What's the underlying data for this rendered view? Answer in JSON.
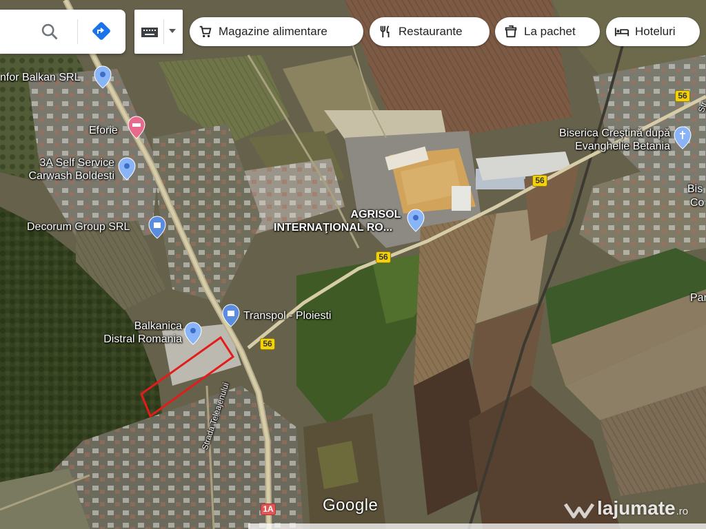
{
  "search": {
    "placeholder": ""
  },
  "filters": [
    {
      "label": "Magazine alimentare",
      "icon": "cart-icon"
    },
    {
      "label": "Restaurante",
      "icon": "fork-knife-icon"
    },
    {
      "label": "La pachet",
      "icon": "takeout-bag-icon"
    },
    {
      "label": "Hoteluri",
      "icon": "bed-icon"
    }
  ],
  "places": {
    "comfor": "nfor Balkan SRL",
    "eforie": "Eforie",
    "carwash_1": "3A Self Service",
    "carwash_2": "Carwash Boldesti",
    "decorum": "Decorum Group SRL",
    "agrisol_1": "AGRISOL",
    "agrisol_2": "INTERNAŢIONAL RO...",
    "transpol": "Transpol - Ploiesti",
    "balkanica_1": "Balkanica",
    "balkanica_2": "Distral Romania",
    "biserica_1": "Biserica Creştină după",
    "biserica_2": "Evanghelie Betania",
    "bis_1": "Bis",
    "bis_2": "Co",
    "par": "Par",
    "strada": "Strada Teleajenului",
    "str_edge": "Str"
  },
  "roads": [
    "56",
    "56",
    "56",
    "56",
    "1A"
  ],
  "branding": {
    "google": "Google",
    "watermark": "lajumate",
    "watermark_tld": ".ro"
  },
  "colors": {
    "marker": "#8ab4f8",
    "marker_alt": "#5a8de0",
    "hotel_marker": "#e7698b",
    "plot_outline": "#e31b1b",
    "road_shield": "#f5d10a"
  }
}
